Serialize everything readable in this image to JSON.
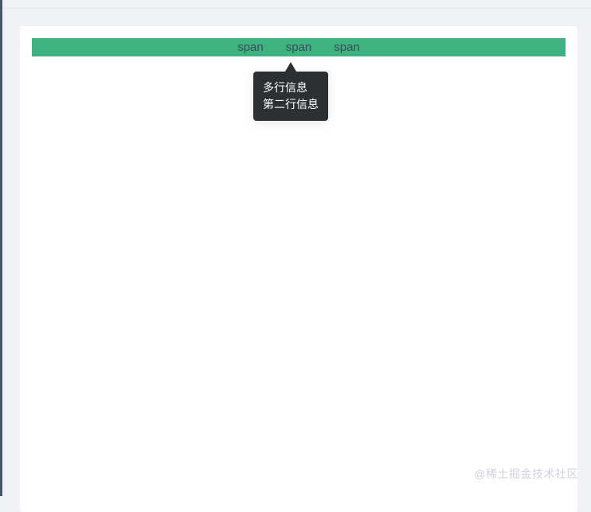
{
  "row": {
    "items": [
      {
        "label": "span"
      },
      {
        "label": "span"
      },
      {
        "label": "span"
      }
    ]
  },
  "tooltip": {
    "line1": "多行信息",
    "line2": "第二行信息"
  },
  "watermark": "@稀土掘金技术社区",
  "colors": {
    "row_bg": "#3eb37f",
    "tooltip_bg": "#2d3033",
    "page_bg": "#f0f2f5"
  }
}
